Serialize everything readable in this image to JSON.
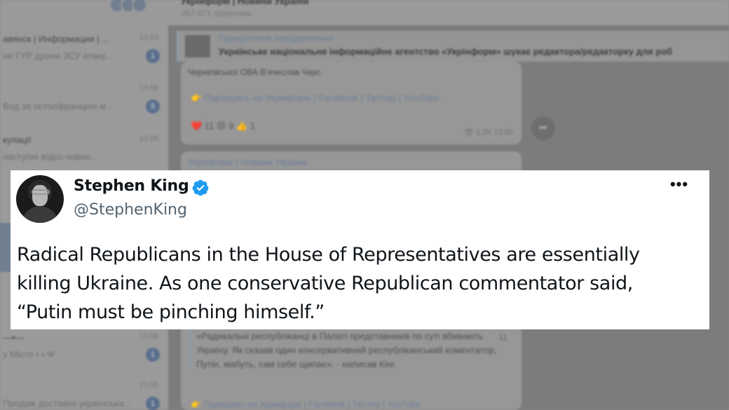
{
  "background": {
    "chat_list": [
      {
        "name": "авянск | Информация | ...",
        "preview": "ни ГУР дрони ЗСУ атаку...",
        "time": "13:59",
        "unread": "1"
      },
      {
        "name": "",
        "preview": "Вод за остолфранцию м...",
        "time": "13:58",
        "unread": "5"
      },
      {
        "name": "купації",
        "preview": "наступні відєо новин...",
        "time": "13:58",
        "unread": ""
      },
      {
        "name": "—•—",
        "preview": "у Місто • • Ψ",
        "time": "13:56",
        "unread": "1"
      },
      {
        "name": "",
        "preview": "Продаж доставка українська...",
        "time": "13:55",
        "unread": "1"
      }
    ],
    "topbar_title": "Укрінформ | Новини України",
    "topbar_subtitle": "357 071 підписник",
    "pinned_label": "Прикріплене повідомлення",
    "pinned_text": "Українське національне інформаційне агентство «Укрінформ» шукає редактора/редакторку для роб",
    "bubble1_line": "Чернігівської ОВА В’ячеслав Чаус.",
    "bubble1_links": "👉 Підпишись на Укрінформ | Facebook | Твіттер | YouTube",
    "bubble1_reactions": "❤️ 11   😢 9   👍 1",
    "bubble1_meta": "👁 1.2K 13:50",
    "bubble2_channel": "Укрінформ | Новини України",
    "bubble2_quote": "«Радикальні республіканці в Палаті представників по суті вбивають Україну. Як сказав один консервативний республіканський коментатор, Путін, мабуть, сам себе щипає», - написав Кінг.",
    "bubble2_qnum": "11",
    "bubble2_footer": "👉 Підпишись на Укрінформ | Facebook | Твіттер | YouTube",
    "forward_icon": "share-icon"
  },
  "tweet": {
    "display_name": "Stephen King",
    "handle": "@StephenKing",
    "verified_icon": "verified-badge-icon",
    "more_icon": "more-options-icon",
    "more_label": "•••",
    "text_lines": [
      "Radical Republicans in the House of Representatives are essentially",
      "killing Ukraine. As one conservative Republican commentator said,",
      "“Putin must be pinching himself.”"
    ],
    "colors": {
      "name": "#0f1419",
      "handle": "#536471",
      "verified": "#1d9bf0",
      "background": "#ffffff"
    }
  }
}
